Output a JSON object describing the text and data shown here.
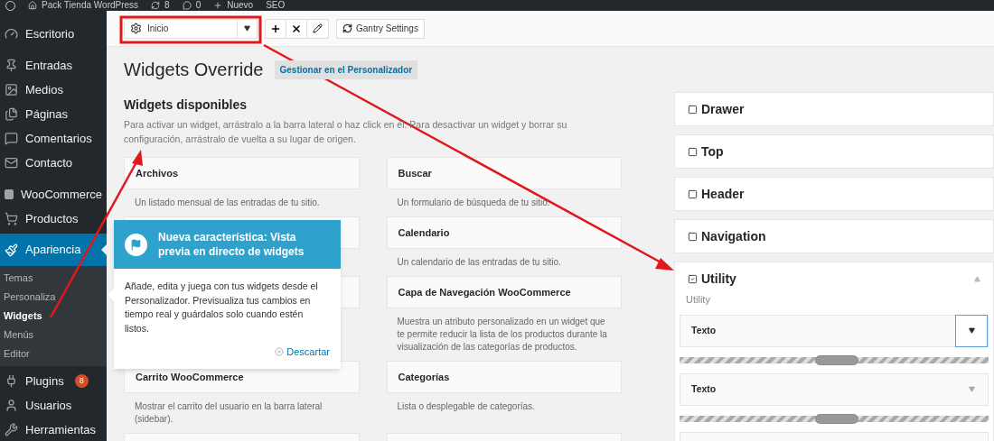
{
  "admin_bar": {
    "site": "Pack Tienda WordPress",
    "updates": "8",
    "comments": "0",
    "new": "Nuevo",
    "seo": "SEO"
  },
  "sidebar": {
    "items": [
      {
        "label": "Escritorio",
        "selected": false
      },
      {
        "label": "Entradas",
        "selected": false
      },
      {
        "label": "Medios",
        "selected": false
      },
      {
        "label": "Páginas",
        "selected": false
      },
      {
        "label": "Comentarios",
        "selected": false
      },
      {
        "label": "Contacto",
        "selected": false
      },
      {
        "label": "WooCommerce",
        "selected": false
      },
      {
        "label": "Productos",
        "selected": false
      },
      {
        "label": "Apariencia",
        "selected": true,
        "children": [
          {
            "label": "Temas",
            "selected": false
          },
          {
            "label": "Personaliza",
            "selected": false
          },
          {
            "label": "Widgets",
            "selected": true
          },
          {
            "label": "Menús",
            "selected": false
          },
          {
            "label": "Editor",
            "selected": false
          }
        ]
      },
      {
        "label": "Plugins",
        "selected": false,
        "badge": "8"
      },
      {
        "label": "Usuarios",
        "selected": false
      },
      {
        "label": "Herramientas",
        "selected": false
      }
    ]
  },
  "toolbar": {
    "dropdown": {
      "value": "Inicio"
    },
    "settings_button": "Gantry Settings"
  },
  "page": {
    "title": "Widgets Override",
    "action": "Gestionar en el Personalizador"
  },
  "available": {
    "title": "Widgets disponibles",
    "description": "Para activar un widget, arrástralo a la barra lateral o haz click en él. Para desactivar un widget y borrar su configuración, arrástralo de vuelta a su lugar de origen.",
    "widgets": [
      {
        "kind": "widget",
        "title": "Archivos",
        "description": "Un listado mensual de las entradas de tu sitio."
      },
      {
        "kind": "widget",
        "title": "Buscar",
        "description": "Un formulario de búsqueda de tu sitio."
      },
      {
        "kind": "covered"
      },
      {
        "kind": "widget",
        "title": "Calendario",
        "description": "Un calendario de las entradas de tu sitio."
      },
      {
        "kind": "covered"
      },
      {
        "kind": "widget",
        "title": "Capa de Navegación WooCommerce",
        "description": "Muestra un atributo personalizado en un widget que te permite reducir la lista de los productos durante la visualización de las categorías de productos."
      },
      {
        "kind": "widget",
        "title": "Carrito WooCommerce",
        "description": "Mostrar el carrito del usuario en la barra lateral (sidebar)."
      },
      {
        "kind": "widget",
        "title": "Categorías",
        "description": "Lista o desplegable de categorías."
      },
      {
        "kind": "covered"
      },
      {
        "kind": "covered"
      }
    ]
  },
  "sidebars": [
    {
      "title": "Drawer",
      "checked": false,
      "expanded": false
    },
    {
      "title": "Top",
      "checked": false,
      "expanded": false
    },
    {
      "title": "Header",
      "checked": false,
      "expanded": false
    },
    {
      "title": "Navigation",
      "checked": false,
      "expanded": false
    },
    {
      "title": "Utility",
      "checked": true,
      "expanded": true,
      "description": "Utility",
      "widgets": [
        {
          "title": "Texto",
          "selected": true
        },
        {
          "title": "Texto",
          "selected": false
        }
      ]
    }
  ],
  "pointer": {
    "title": "Nueva característica: Vista previa en directo de widgets",
    "body": "Añade, edita y juega con tus widgets desde el Personalizador. Previsualiza tus cambios en tiempo real y guárdalos solo cuando estén listos.",
    "dismiss": "Descartar"
  }
}
